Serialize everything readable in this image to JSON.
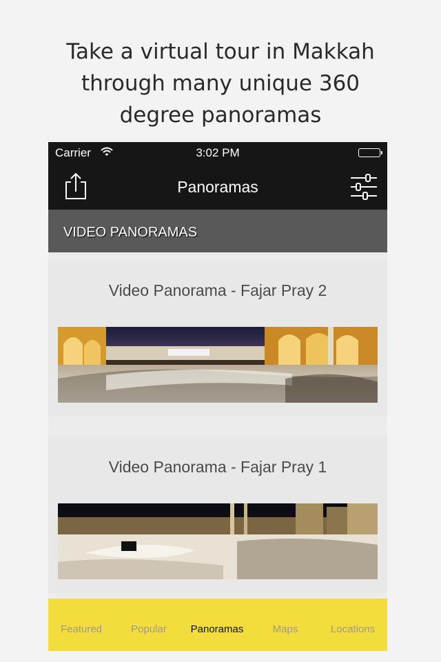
{
  "promo": {
    "line1": "Take a virtual tour in Makkah",
    "line2": "through many unique 360",
    "line3": "degree panoramas"
  },
  "status_bar": {
    "carrier": "Carrier",
    "time": "3:02 PM"
  },
  "nav": {
    "title": "Panoramas",
    "left_icon": "share-icon",
    "right_icon": "sliders-icon"
  },
  "section": {
    "title": "VIDEO PANORAMAS"
  },
  "panoramas": [
    {
      "title": "Video Panorama - Fajar Pray 2"
    },
    {
      "title": "Video Panorama - Fajar Pray 1"
    }
  ],
  "tabs": [
    {
      "label": "Featured"
    },
    {
      "label": "Popular"
    },
    {
      "label": "Panoramas",
      "active": true
    },
    {
      "label": "Maps"
    },
    {
      "label": "Locations"
    }
  ],
  "colors": {
    "nav_bg": "#161616",
    "section_bg": "#595959",
    "tabbar_bg": "#f3dd3c",
    "tab_inactive": "#a09a86",
    "tab_active": "#111111"
  }
}
